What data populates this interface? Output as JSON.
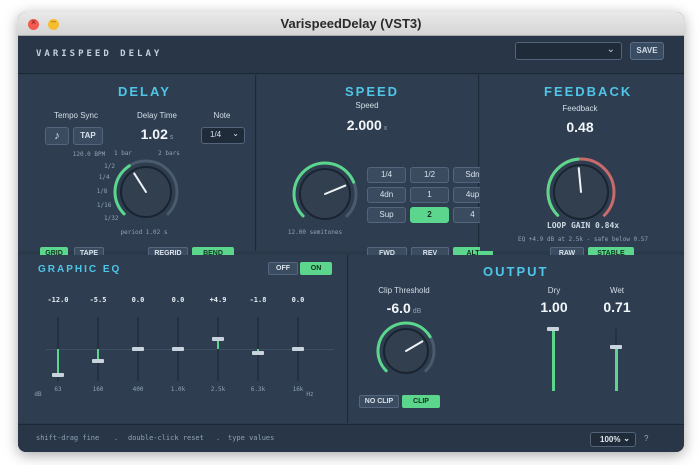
{
  "window": {
    "title": "VarispeedDelay (VST3)",
    "close_glyph": "×",
    "min_glyph": "–"
  },
  "header": {
    "plugin_name": "VARISPEED DELAY",
    "preset_value": "",
    "save_label": "SAVE"
  },
  "delay": {
    "title": "DELAY",
    "tempo_sync_label": "Tempo Sync",
    "note_icon": "♪",
    "tap_label": "TAP",
    "bpm": "120.0 BPM",
    "delay_time_label": "Delay Time",
    "delay_time_value": "1.02",
    "delay_time_unit": "s",
    "note_label": "Note",
    "note_value": "1/4",
    "division_ticks": [
      "1 bar",
      "2 bars",
      "1/2",
      "1/4",
      "1/8",
      "1/16",
      "1/32"
    ],
    "period": "period 1.02 s",
    "knob_level": 0.38,
    "grid_label": "GRID",
    "tape_label": "TAPE",
    "regrid_label": "REGRID",
    "bend_label": "BEND"
  },
  "speed": {
    "title": "SPEED",
    "speed_label": "Speed",
    "speed_value": "2.000",
    "speed_unit": "x",
    "semitones": "12.00 semitones",
    "knob_level": 0.75,
    "grid": [
      "1/4",
      "1/2",
      "Sdn",
      "4dn",
      "1",
      "4up",
      "Sup",
      "2",
      "4"
    ],
    "active_index": 7,
    "fwd_label": "FWD",
    "rev_label": "REV",
    "alt_label": "ALT"
  },
  "feedback": {
    "title": "FEEDBACK",
    "feedback_label": "Feedback",
    "feedback_value": "0.48",
    "loop_gain": "LOOP GAIN 0.84x",
    "info": "EQ +4.9 dB at 2.5k - safe below 0.57",
    "knob_level": 0.48,
    "raw_label": "RAW",
    "stable_label": "STABLE"
  },
  "eq": {
    "title": "GRAPHIC EQ",
    "off_label": "OFF",
    "on_label": "ON",
    "bands": [
      {
        "value": "-12.0",
        "freq": "63",
        "gain": -12.0
      },
      {
        "value": "-5.5",
        "freq": "160",
        "gain": -5.5
      },
      {
        "value": "0.0",
        "freq": "400",
        "gain": 0.0
      },
      {
        "value": "0.0",
        "freq": "1.0k",
        "gain": 0.0
      },
      {
        "value": "+4.9",
        "freq": "2.5k",
        "gain": 4.9
      },
      {
        "value": "-1.8",
        "freq": "6.3k",
        "gain": -1.8
      },
      {
        "value": "0.0",
        "freq": "16k",
        "gain": 0.0
      }
    ],
    "db_label": "dB",
    "hz_label": "Hz"
  },
  "output": {
    "title": "OUTPUT",
    "clip_label": "Clip Threshold",
    "clip_value": "-6.0",
    "clip_unit": "dB",
    "clip_level": 0.72,
    "no_clip_label": "NO CLIP",
    "clip_btn_label": "CLIP",
    "dry_label": "Dry",
    "dry_value": "1.00",
    "dry_level": 1.0,
    "wet_label": "Wet",
    "wet_value": "0.71",
    "wet_level": 0.71
  },
  "footer": {
    "hint1": "shift-drag fine",
    "sep": ".",
    "hint2": "double-click reset",
    "hint3": "type values",
    "zoom": "100%",
    "help": "?"
  },
  "colors": {
    "accent": "#4fc5e8",
    "green": "#5bd68c",
    "knob_arc_red": "#c86b6b",
    "bg": "#2b3a4a"
  }
}
